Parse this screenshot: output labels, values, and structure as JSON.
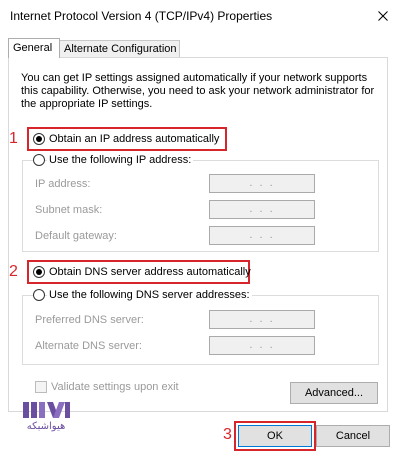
{
  "window": {
    "title": "Internet Protocol Version 4 (TCP/IPv4) Properties"
  },
  "tabs": [
    {
      "label": "General"
    },
    {
      "label": "Alternate Configuration"
    }
  ],
  "description": "You can get IP settings assigned automatically if your network supports this capability. Otherwise, you need to ask your network administrator for the appropriate IP settings.",
  "ip_section": {
    "auto_label": "Obtain an IP address automatically",
    "manual_label": "Use the following IP address:",
    "fields": [
      {
        "label": "IP address:",
        "value": ".   .   ."
      },
      {
        "label": "Subnet mask:",
        "value": ".   .   ."
      },
      {
        "label": "Default gateway:",
        "value": ".   .   ."
      }
    ]
  },
  "dns_section": {
    "auto_label": "Obtain DNS server address automatically",
    "manual_label": "Use the following DNS server addresses:",
    "fields": [
      {
        "label": "Preferred DNS server:",
        "value": ".   .   ."
      },
      {
        "label": "Alternate DNS server:",
        "value": ".   .   ."
      }
    ]
  },
  "validate_label": "Validate settings upon exit",
  "buttons": {
    "advanced": "Advanced...",
    "ok": "OK",
    "cancel": "Cancel"
  },
  "annotations": {
    "step1": "1",
    "step2": "2",
    "step3": "3"
  },
  "watermark": {
    "brand_text": "هیواشبکه"
  },
  "colors": {
    "highlight": "#d7262b",
    "accent": "#0078d7",
    "logo": "#6a4fa0"
  },
  "icons": {
    "close": "close-icon",
    "logo": "brand-logo-icon"
  }
}
